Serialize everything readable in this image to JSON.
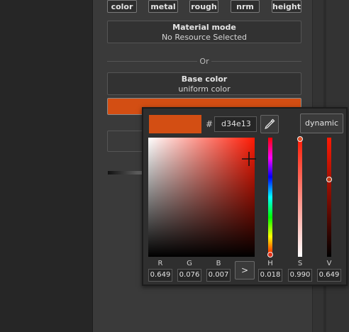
{
  "channels": [
    "color",
    "metal",
    "rough",
    "nrm",
    "height"
  ],
  "material_mode": {
    "title": "Material mode",
    "value": "No Resource Selected"
  },
  "divider_text": "Or",
  "base_color": {
    "title": "Base color",
    "value": "uniform color",
    "swatch": "#d34e13"
  },
  "picker": {
    "current_color": "#d34e13",
    "hash": "#",
    "hex": "d34e13",
    "dynamic_label": "dynamic",
    "arrow_label": ">",
    "hue_level": 0.018,
    "saturation_level": 0.99,
    "value_level": 0.649,
    "fields": [
      {
        "label": "R",
        "value": "0.649"
      },
      {
        "label": "G",
        "value": "0.076"
      },
      {
        "label": "B",
        "value": "0.007"
      },
      {
        "label": "H",
        "value": "0.018"
      },
      {
        "label": "S",
        "value": "0.990"
      },
      {
        "label": "V",
        "value": "0.649"
      }
    ]
  },
  "icons": {
    "eyedropper": "eyedropper-icon",
    "crosshair": "crosshair-icon"
  }
}
